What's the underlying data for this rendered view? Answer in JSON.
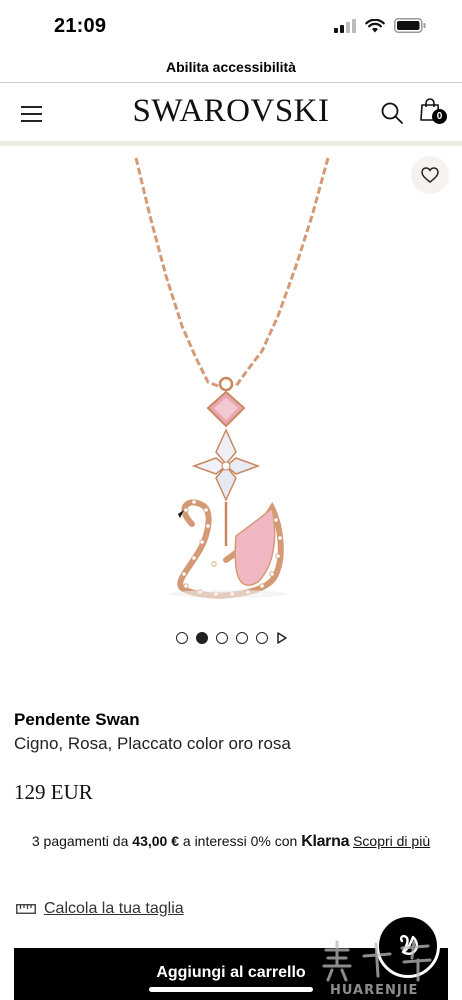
{
  "status_bar": {
    "time": "21:09"
  },
  "accessibility": {
    "label": "Abilita accessibilità"
  },
  "header": {
    "logo": "SWAROVSKI",
    "bag_count": "0"
  },
  "gallery": {
    "slide_count": 5,
    "active_slide": 2
  },
  "product": {
    "name": "Pendente Swan",
    "description": "Cigno, Rosa, Placcato color oro rosa",
    "price": "129 EUR"
  },
  "installments": {
    "prefix": "3 pagamenti da",
    "amount": "43,00 €",
    "middle": "a interessi 0% con",
    "provider": "Klarna",
    "link": "Scopri di più"
  },
  "size_calculator": {
    "label": "Calcola la tua taglia"
  },
  "add_to_cart": {
    "label": "Aggiungi al carrello"
  },
  "watermark": {
    "text": "HUARENJIE"
  },
  "colors": {
    "accent": "#000000",
    "band": "#eeeae4",
    "rose_gold": "#d49a76",
    "pink_stone": "#e9a7b4"
  }
}
